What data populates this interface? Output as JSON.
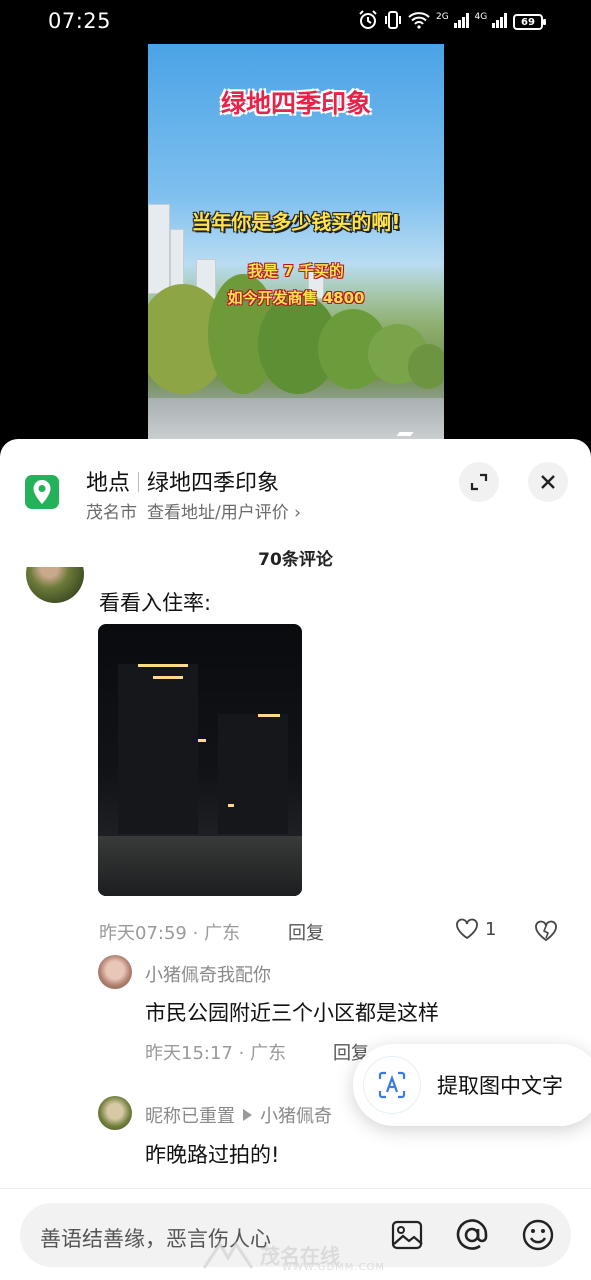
{
  "status_bar": {
    "time": "07:25",
    "signal1_label": "2G",
    "signal2_label": "4G",
    "battery": "69",
    "icons": [
      "alarm-icon",
      "vibrate-icon",
      "wifi-icon",
      "signal-icon",
      "signal-icon",
      "battery-icon"
    ]
  },
  "video": {
    "title": "绿地四季印象",
    "question": "当年你是多少钱买的啊!",
    "answer_line1": "我是 7 千买的",
    "answer_line2": "如今开发商售 4800"
  },
  "location": {
    "icon": "location-pin-icon",
    "label": "地点",
    "name": "绿地四季印象",
    "city": "茂名市",
    "link": "查看地址/用户评价",
    "link_arrow": "›",
    "accent_color": "#23b25a"
  },
  "comments": {
    "count_label": "70条评论",
    "items": [
      {
        "text": "看看入住率:",
        "time": "昨天07:59",
        "dot": "·",
        "region": "广东",
        "reply": "回复",
        "likes": "1",
        "replies": [
          {
            "user": "小猪佩奇我配你",
            "text": "市民公园附近三个小区都是这样",
            "time": "昨天15:17",
            "dot": "·",
            "region": "广东",
            "reply": "回复"
          },
          {
            "user": "昵称已重置",
            "reply_to": "小猪佩奇",
            "text": "昨晚路过拍的!"
          }
        ]
      }
    ]
  },
  "ocr_popup": {
    "icon": "text-scan-icon",
    "label": "提取图中文字"
  },
  "input": {
    "placeholder": "善语结善缘，恶言伤人心"
  },
  "watermark": {
    "text": "茂名在线",
    "url": "WWW.GDMM.COM"
  }
}
